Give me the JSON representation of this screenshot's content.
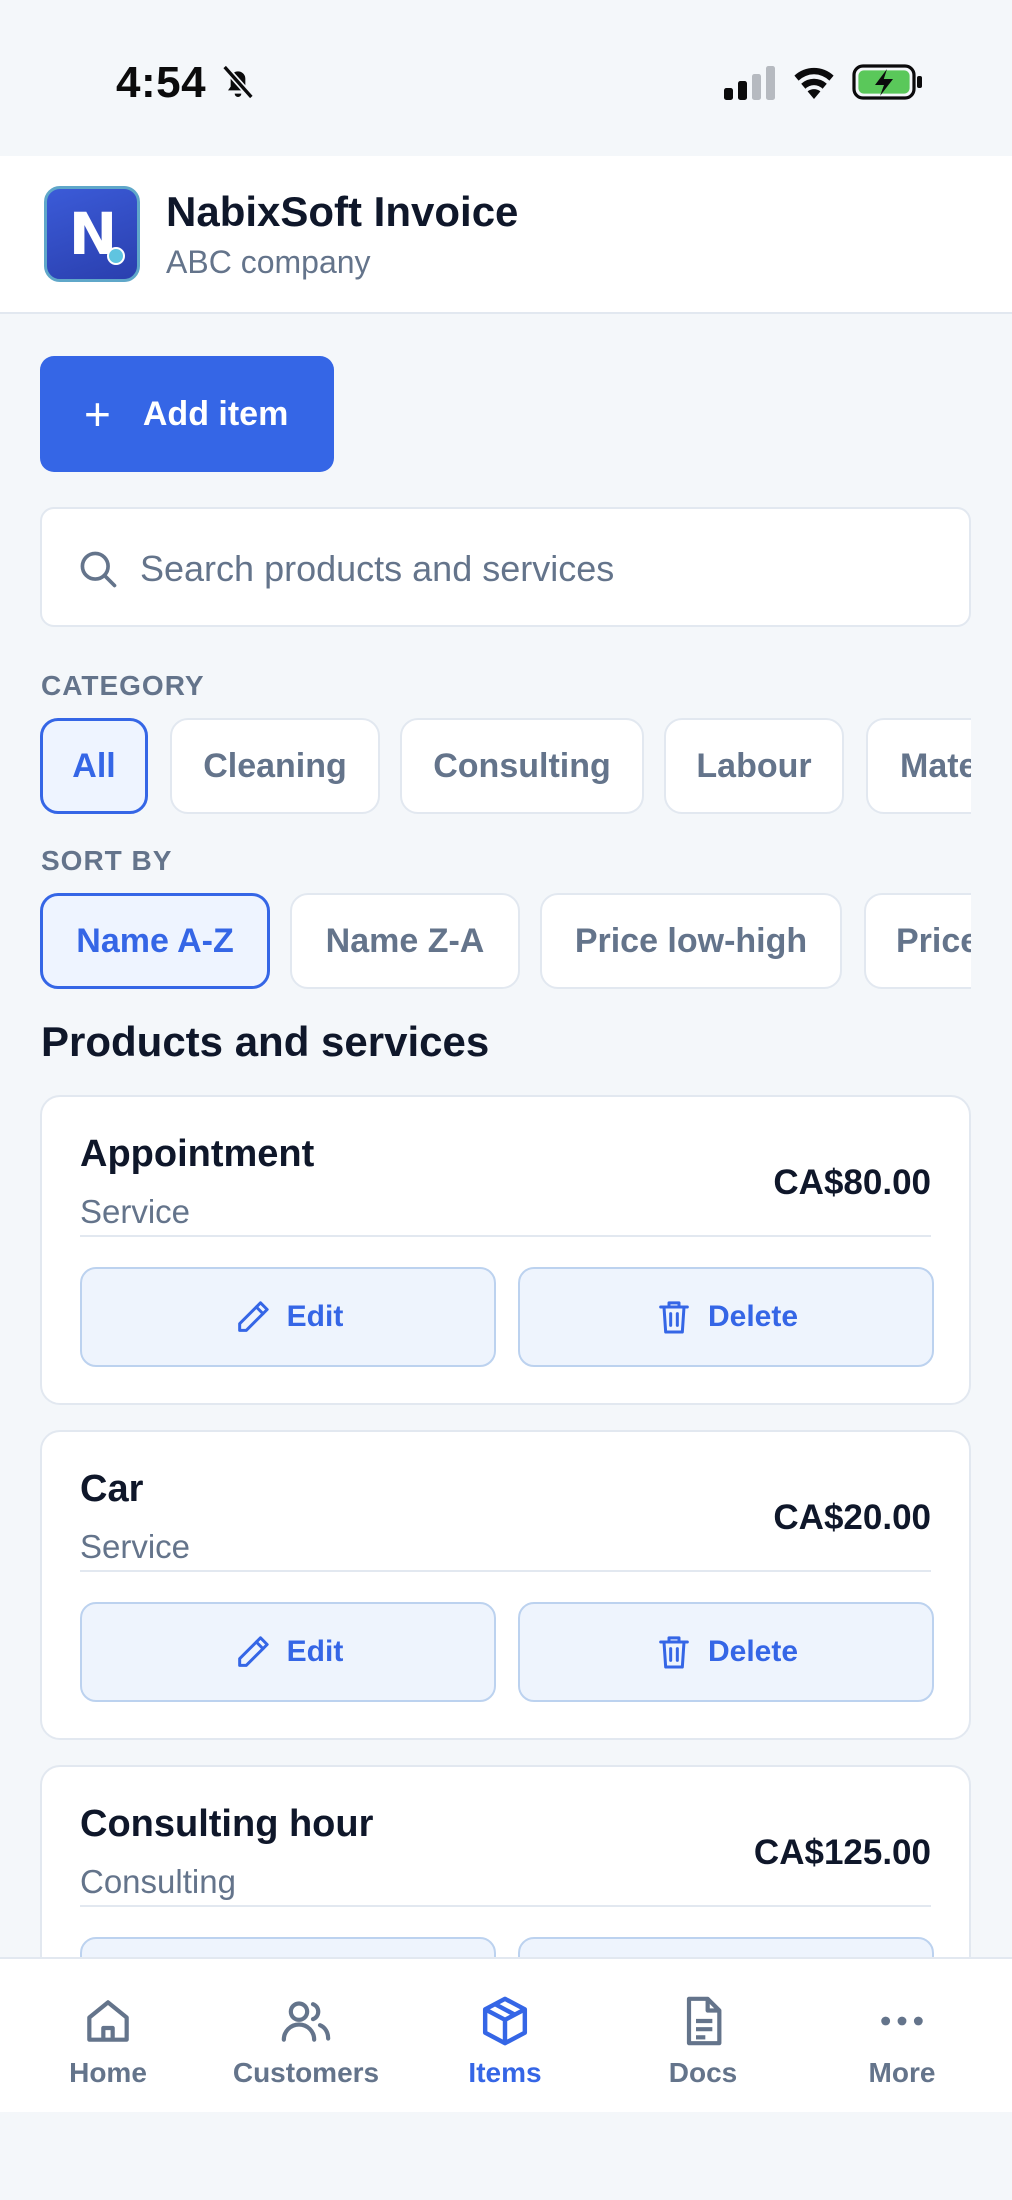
{
  "status_bar": {
    "time": "4:54"
  },
  "header": {
    "title": "NabixSoft Invoice",
    "subtitle": "ABC company",
    "logo_letter": "N"
  },
  "actions": {
    "add_item_label": "Add item"
  },
  "search": {
    "placeholder": "Search products and services",
    "value": ""
  },
  "filters": {
    "category_label": "CATEGORY",
    "categories": [
      "All",
      "Cleaning",
      "Consulting",
      "Labour",
      "Mate"
    ],
    "active_category": "All",
    "sort_label": "SORT BY",
    "sort_options": [
      "Name A-Z",
      "Name Z-A",
      "Price low-high",
      "Price"
    ],
    "active_sort": "Name A-Z"
  },
  "list": {
    "heading": "Products and services",
    "edit_label": "Edit",
    "delete_label": "Delete",
    "items": [
      {
        "name": "Appointment",
        "category": "Service",
        "price": "CA$80.00"
      },
      {
        "name": "Car",
        "category": "Service",
        "price": "CA$20.00"
      },
      {
        "name": "Consulting hour",
        "category": "Consulting",
        "price": "CA$125.00"
      }
    ]
  },
  "tab_bar": {
    "tabs": [
      {
        "label": "Home",
        "icon": "home-icon"
      },
      {
        "label": "Customers",
        "icon": "users-icon"
      },
      {
        "label": "Items",
        "icon": "box-icon"
      },
      {
        "label": "Docs",
        "icon": "document-icon"
      },
      {
        "label": "More",
        "icon": "more-icon"
      }
    ],
    "active": "Items"
  },
  "colors": {
    "accent": "#3566e6",
    "muted_text": "#64748b",
    "border": "#e2e8f0",
    "background": "#f4f7fa",
    "chip_active_bg": "#eef4ff",
    "button_soft_bg": "#eef4fd"
  }
}
